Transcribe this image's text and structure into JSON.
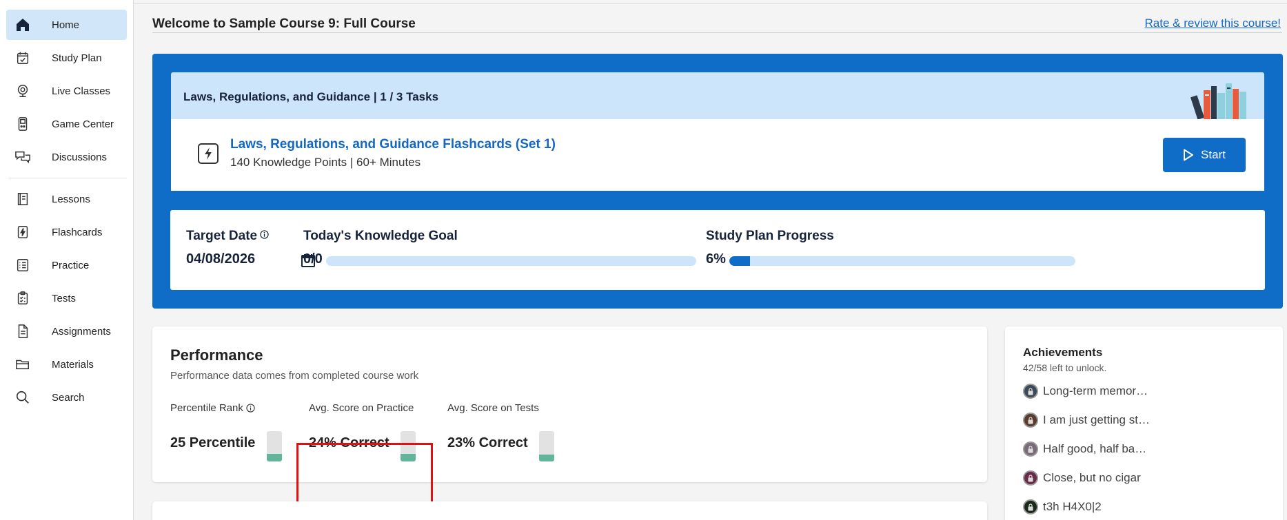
{
  "sidebar": {
    "items": [
      {
        "label": "Home",
        "icon": "home-icon",
        "active": true
      },
      {
        "label": "Study Plan",
        "icon": "calendar-check-icon"
      },
      {
        "label": "Live Classes",
        "icon": "webcam-icon"
      },
      {
        "label": "Game Center",
        "icon": "gameboy-icon"
      },
      {
        "label": "Discussions",
        "icon": "chat-bubbles-icon"
      },
      {
        "label": "Lessons",
        "icon": "book-icon"
      },
      {
        "label": "Flashcards",
        "icon": "flashcard-icon"
      },
      {
        "label": "Practice",
        "icon": "checklist-icon"
      },
      {
        "label": "Tests",
        "icon": "clipboard-icon"
      },
      {
        "label": "Assignments",
        "icon": "document-icon"
      },
      {
        "label": "Materials",
        "icon": "folder-icon"
      },
      {
        "label": "Search",
        "icon": "search-icon"
      }
    ]
  },
  "header": {
    "title": "Welcome to Sample Course 9: Full Course",
    "rate_link": "Rate & review this course!"
  },
  "task": {
    "heading": "Laws, Regulations, and Guidance | 1 / 3 Tasks",
    "name": "Laws, Regulations, and Guidance Flashcards (Set 1)",
    "meta": "140 Knowledge Points |  60+ Minutes",
    "start_label": "Start"
  },
  "stats": {
    "target_date_label": "Target Date",
    "target_date_value": "04/08/2026",
    "knowledge_goal_label": "Today's Knowledge Goal",
    "knowledge_goal_value": "0/0",
    "knowledge_goal_fraction": 0,
    "progress_label": "Study Plan Progress",
    "progress_value": "6%",
    "progress_fraction": 0.06
  },
  "performance": {
    "title": "Performance",
    "subtitle": "Performance data comes from completed course work",
    "metrics": [
      {
        "label": "Percentile Rank",
        "value": "25 Percentile",
        "fraction": 0.25
      },
      {
        "label": "Avg. Score on Practice",
        "value": "24% Correct",
        "fraction": 0.24
      },
      {
        "label": "Avg. Score on Tests",
        "value": "23% Correct",
        "fraction": 0.23
      }
    ]
  },
  "achievements": {
    "title": "Achievements",
    "subtitle": "42/58 left to unlock.",
    "items": [
      {
        "label": "Long-term memor…",
        "color": "#3b4a5a"
      },
      {
        "label": "I am just getting st…",
        "color": "#5a3a2a"
      },
      {
        "label": "Half good, half ba…",
        "color": "#7a6a78"
      },
      {
        "label": "Close, but no cigar",
        "color": "#6a2a4a"
      },
      {
        "label": "t3h H4X0|2",
        "color": "#1a2a1a"
      }
    ]
  },
  "colors": {
    "brand_blue": "#0f6cc7",
    "light_blue": "#cde5fa",
    "score_green": "#62b59a",
    "highlight_red": "#e21010"
  }
}
